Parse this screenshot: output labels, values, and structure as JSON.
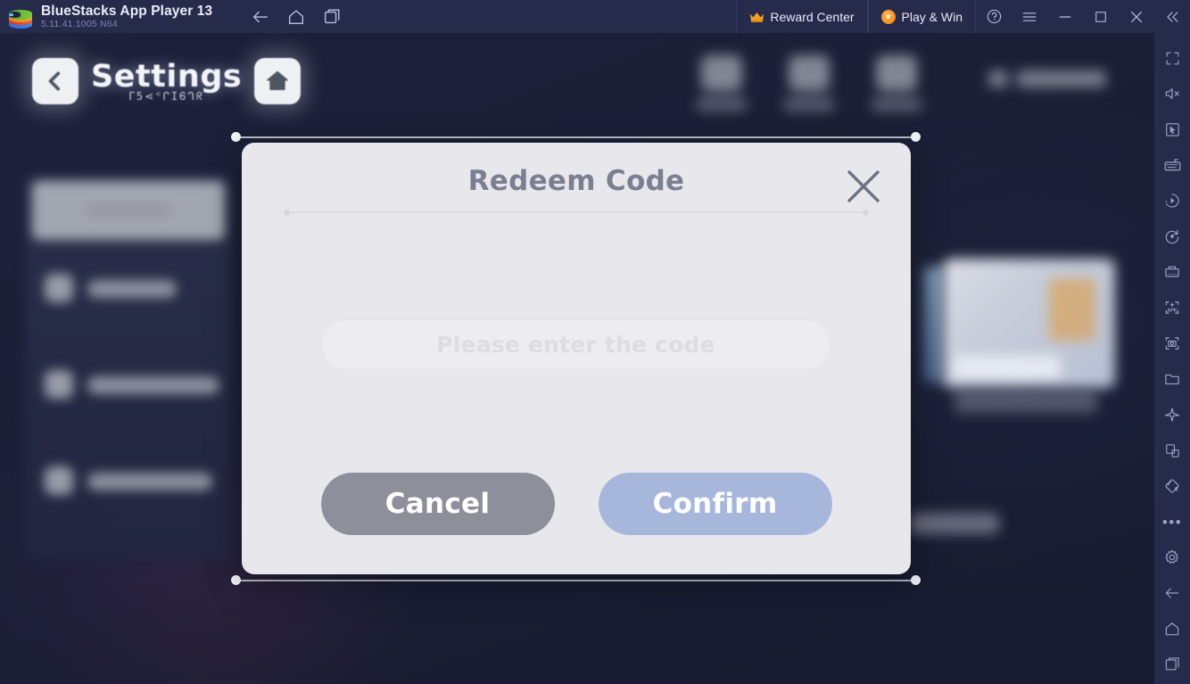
{
  "titlebar": {
    "app_name": "BlueStacks App Player 13",
    "version": "5.11.41.1005  N64",
    "logo_icon": "bluestacks-logo",
    "nav": [
      {
        "icon": "back-arrow-icon",
        "name": "android-back"
      },
      {
        "icon": "home-icon",
        "name": "android-home"
      },
      {
        "icon": "recents-icon",
        "name": "android-recents"
      }
    ],
    "reward_center": {
      "label": "Reward Center",
      "icon": "crown-icon"
    },
    "play_and_win": {
      "label": "Play & Win",
      "icon": "star-badge-icon"
    },
    "window_controls": [
      {
        "icon": "help-icon",
        "name": "help-button"
      },
      {
        "icon": "hamburger-menu-icon",
        "name": "menu-button"
      },
      {
        "icon": "minimize-icon",
        "name": "minimize-button"
      },
      {
        "icon": "maximize-icon",
        "name": "maximize-button"
      },
      {
        "icon": "close-icon",
        "name": "close-button"
      },
      {
        "icon": "collapse-chevrons-icon",
        "name": "collapse-button"
      }
    ]
  },
  "sidebar_right": {
    "items": [
      {
        "icon": "fullscreen-icon",
        "name": "fullscreen"
      },
      {
        "icon": "mute-icon",
        "name": "mute-volume"
      },
      {
        "icon": "cursor-pointer-icon",
        "name": "game-controls-cursor"
      },
      {
        "icon": "keyboard-icon",
        "name": "keyboard-controls"
      },
      {
        "icon": "macro-play-icon",
        "name": "macro-recorder"
      },
      {
        "icon": "rotate-icon",
        "name": "rotate-screen"
      },
      {
        "icon": "multi-instance-icon",
        "name": "multi-instance-manager"
      },
      {
        "icon": "install-apk-icon",
        "name": "install-apk"
      },
      {
        "icon": "screenshot-icon",
        "name": "take-screenshot"
      },
      {
        "icon": "folder-icon",
        "name": "media-manager"
      },
      {
        "icon": "eco-mode-icon",
        "name": "eco-mode"
      },
      {
        "icon": "clone-icon",
        "name": "clone-instance"
      },
      {
        "icon": "shake-icon",
        "name": "shake-device"
      },
      {
        "icon": "more-dots-icon",
        "name": "more-options"
      },
      {
        "icon": "gear-icon",
        "name": "settings"
      },
      {
        "icon": "back-arrow-icon",
        "name": "android-back"
      },
      {
        "icon": "home-icon",
        "name": "android-home"
      },
      {
        "icon": "recents-icon",
        "name": "android-recents"
      }
    ]
  },
  "game": {
    "header": {
      "back_icon": "back-chevron-icon",
      "title": "Settings",
      "subtitle_runic": "ᒥ5⋖ᑉᒋІᏮᒉᖇ",
      "home_icon": "home-icon"
    }
  },
  "dialog": {
    "title": "Redeem Code",
    "close_icon": "close-x-icon",
    "input": {
      "placeholder": "Please enter the code",
      "value": ""
    },
    "cancel_label": "Cancel",
    "confirm_label": "Confirm"
  },
  "colors": {
    "titlebar_bg": "#262b4c",
    "dialog_bg": "#e8e8ec",
    "dialog_title": "#7c7f92",
    "cancel_btn": "#8f8f9c",
    "confirm_btn": "#a6b7db",
    "accent_orange": "#f0941c"
  }
}
